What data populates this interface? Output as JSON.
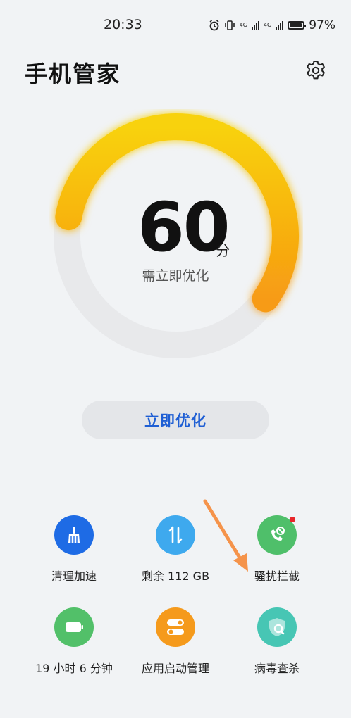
{
  "status_bar": {
    "time": "20:33",
    "network_1": "4G",
    "network_2": "4G",
    "battery": "97%"
  },
  "header": {
    "title": "手机管家",
    "settings_icon": "gear-icon"
  },
  "score": {
    "value": "60",
    "unit": "分",
    "status": "需立即优化",
    "level": 0.6,
    "colors": {
      "track": "#e8e9eb",
      "arc_start": "#f8d20a",
      "arc_end": "#f79b13"
    }
  },
  "optimize_button": {
    "label": "立即优化"
  },
  "features": [
    {
      "label": "清理加速",
      "icon": "broom-icon",
      "color": "#1e6be5"
    },
    {
      "label": "剩余 112 GB",
      "icon": "storage-transfer-icon",
      "color": "#3ea9ee"
    },
    {
      "label": "骚扰拦截",
      "icon": "phone-block-icon",
      "color": "#4fbf6a",
      "has_badge": true
    },
    {
      "label": "19 小时 6 分钟",
      "icon": "battery-icon",
      "color": "#52c069"
    },
    {
      "label": "应用启动管理",
      "icon": "toggle-icon",
      "color": "#f59a1c"
    },
    {
      "label": "病毒查杀",
      "icon": "shield-search-icon",
      "color": "#47c6b4"
    }
  ],
  "annotation": {
    "color": "#f5934a"
  }
}
